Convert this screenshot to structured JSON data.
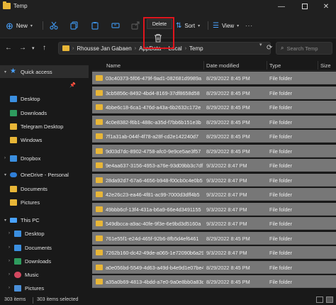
{
  "window": {
    "title": "Temp"
  },
  "toolbar": {
    "new_label": "New",
    "sort_label": "Sort",
    "view_label": "View",
    "more_label": "···",
    "delete_tooltip": "Delete",
    "highlight_color": "#e0151d"
  },
  "address": {
    "crumbs": [
      "Rhousse Jan Gabaen",
      "AppData",
      "Local",
      "Temp"
    ],
    "search_placeholder": "Search Temp"
  },
  "sidebar": {
    "items": [
      {
        "label": "Quick access",
        "icon": "star-icon",
        "expander": "▾"
      },
      {
        "label": "Desktop",
        "icon": "desktop-icon"
      },
      {
        "label": "Downloads",
        "icon": "downloads-icon"
      },
      {
        "label": "Telegram Desktop",
        "icon": "folder-icon"
      },
      {
        "label": "Windows",
        "icon": "folder-icon"
      },
      {
        "label": "Dropbox",
        "icon": "dropbox-icon",
        "expander": "›"
      },
      {
        "label": "OneDrive - Personal",
        "icon": "cloud-icon",
        "expander": "▾"
      },
      {
        "label": "Documents",
        "icon": "folder-icon"
      },
      {
        "label": "Pictures",
        "icon": "folder-icon"
      },
      {
        "label": "This PC",
        "icon": "pc-icon",
        "expander": "▾"
      },
      {
        "label": "Desktop",
        "icon": "desktop-icon",
        "expander": "›"
      },
      {
        "label": "Documents",
        "icon": "documents-icon",
        "expander": "›"
      },
      {
        "label": "Downloads",
        "icon": "downloads-icon",
        "expander": "›"
      },
      {
        "label": "Music",
        "icon": "music-icon",
        "expander": "›"
      },
      {
        "label": "Pictures",
        "icon": "pictures-icon",
        "expander": "›"
      }
    ]
  },
  "columns": {
    "name": "Name",
    "date": "Date modified",
    "type": "Type",
    "size": "Size"
  },
  "files": [
    {
      "name": "03c40373-5f06-479f-9ad1-082681d9989a",
      "date": "8/29/2022 8:45 PM",
      "type": "File folder"
    },
    {
      "name": "3cb5856c-8492-4bd4-8169-37df8658d58",
      "date": "8/29/2022 8:45 PM",
      "type": "File folder"
    },
    {
      "name": "4bbe6c18-6ca1-476d-a43a-6b2632c172e",
      "date": "8/29/2022 8:45 PM",
      "type": "File folder"
    },
    {
      "name": "4c0e8382-f6b1-488c-a35d-f7bb6b151e3b",
      "date": "8/29/2022 8:45 PM",
      "type": "File folder"
    },
    {
      "name": "7f1a31ab-044f-4f78-a28f-cd2e142240d7",
      "date": "8/29/2022 8:45 PM",
      "type": "File folder"
    },
    {
      "name": "9d03d7dc-8902-4758-afc0-9e9ce5ae3f57",
      "date": "8/29/2022 8:45 PM",
      "type": "File folder"
    },
    {
      "name": "9e4aa637-3156-4953-a76e-93d09bb3c7df",
      "date": "9/3/2022 8:47 PM",
      "type": "File folder"
    },
    {
      "name": "28da92d7-67a6-4656-b948-f00cb0c4e0b5",
      "date": "9/3/2022 8:47 PM",
      "type": "File folder"
    },
    {
      "name": "42e26c23-ea46-4f81-ac99-7000d3dff4b5",
      "date": "9/3/2022 8:47 PM",
      "type": "File folder"
    },
    {
      "name": "49bbb6cf-13f4-431a-b6a9-66e4d3491155",
      "date": "9/3/2022 8:47 PM",
      "type": "File folder"
    },
    {
      "name": "549dbcca-a9ac-40fe-9f3e-6e9bd3d5160a",
      "date": "9/3/2022 8:47 PM",
      "type": "File folder"
    },
    {
      "name": "761e55f1-e24d-465f-92b6-8fb5d4ef6461",
      "date": "8/29/2022 8:45 PM",
      "type": "File folder"
    },
    {
      "name": "7262b160-dc42-49de-a065-1e72090b6a29",
      "date": "9/3/2022 8:47 PM",
      "type": "File folder"
    },
    {
      "name": "a0e056bd-5549-4d63-a49d-b4e9d1e07be4",
      "date": "8/29/2022 8:45 PM",
      "type": "File folder"
    },
    {
      "name": "a35a0b69-4813-4bdd-a7e0-9a0e8bb0a83d",
      "date": "8/29/2022 8:45 PM",
      "type": "File folder"
    }
  ],
  "status": {
    "count": "303 items",
    "selected": "303 items selected"
  }
}
